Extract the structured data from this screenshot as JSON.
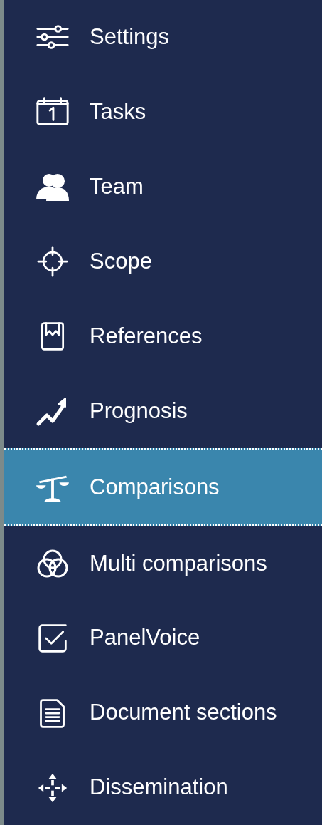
{
  "nav_items": [
    {
      "label": "Settings",
      "selected": false
    },
    {
      "label": "Tasks",
      "selected": false
    },
    {
      "label": "Team",
      "selected": false
    },
    {
      "label": "Scope",
      "selected": false
    },
    {
      "label": "References",
      "selected": false
    },
    {
      "label": "Prognosis",
      "selected": false
    },
    {
      "label": "Comparisons",
      "selected": true
    },
    {
      "label": "Multi comparisons",
      "selected": false
    },
    {
      "label": "PanelVoice",
      "selected": false
    },
    {
      "label": "Document sections",
      "selected": false
    },
    {
      "label": "Dissemination",
      "selected": false
    }
  ]
}
